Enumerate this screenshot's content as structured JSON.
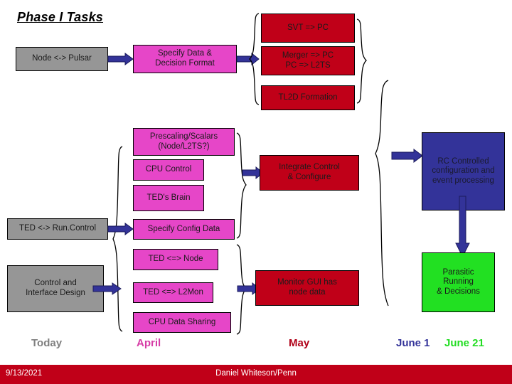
{
  "slide": {
    "title": "Phase I Tasks"
  },
  "boxes": {
    "node_pulsar": {
      "label": "Node <-> Pulsar",
      "color": "#969696"
    },
    "specify_data": {
      "label": "Specify Data &\nDecision Format",
      "color": "#e646c8"
    },
    "svt_pc": {
      "label": "SVT => PC",
      "color": "#c00018"
    },
    "merger_pc": {
      "label": "Merger => PC\nPC => L2TS",
      "color": "#c00018"
    },
    "tl2d_formation": {
      "label": "TL2D Formation",
      "color": "#c00018"
    },
    "prescaling": {
      "label": "Prescaling/Scalars\n(Node/L2TS?)",
      "color": "#e646c8"
    },
    "cpu_control": {
      "label": "CPU Control",
      "color": "#e646c8"
    },
    "teds_brain": {
      "label": "TED's Brain",
      "color": "#e646c8"
    },
    "specify_config": {
      "label": "Specify Config Data",
      "color": "#e646c8"
    },
    "ted_node": {
      "label": "TED <=> Node",
      "color": "#e646c8"
    },
    "ted_l2mon": {
      "label": "TED <=> L2Mon",
      "color": "#e646c8"
    },
    "cpu_data_sharing": {
      "label": "CPU Data Sharing",
      "color": "#e646c8"
    },
    "ted_runcontrol": {
      "label": "TED <-> Run.Control",
      "color": "#969696"
    },
    "control_interface": {
      "label": "Control and\nInterface Design",
      "color": "#969696"
    },
    "integrate_control": {
      "label": "Integrate Control\n& Configure",
      "color": "#c00018"
    },
    "monitor_gui": {
      "label": "Monitor GUI has\nnode data",
      "color": "#c00018"
    },
    "rc_controlled": {
      "label": "RC Controlled\nconfiguration and\nevent processing",
      "color": "#333399"
    },
    "parasitic_running": {
      "label": "Parasitic\nRunning\n& Decisions",
      "color": "#22e022"
    }
  },
  "timeline": {
    "today": {
      "label": "Today",
      "color": "#808080"
    },
    "april": {
      "label": "April",
      "color": "#d63ca6"
    },
    "may": {
      "label": "May",
      "color": "#b00018"
    },
    "june1": {
      "label": "June 1",
      "color": "#333399"
    },
    "june21": {
      "label": "June 21",
      "color": "#22dd22"
    }
  },
  "footer": {
    "date": "9/13/2021",
    "author": "Daniel Whiteson/Penn",
    "background": "#c00018"
  },
  "arrow_color": "#333399"
}
